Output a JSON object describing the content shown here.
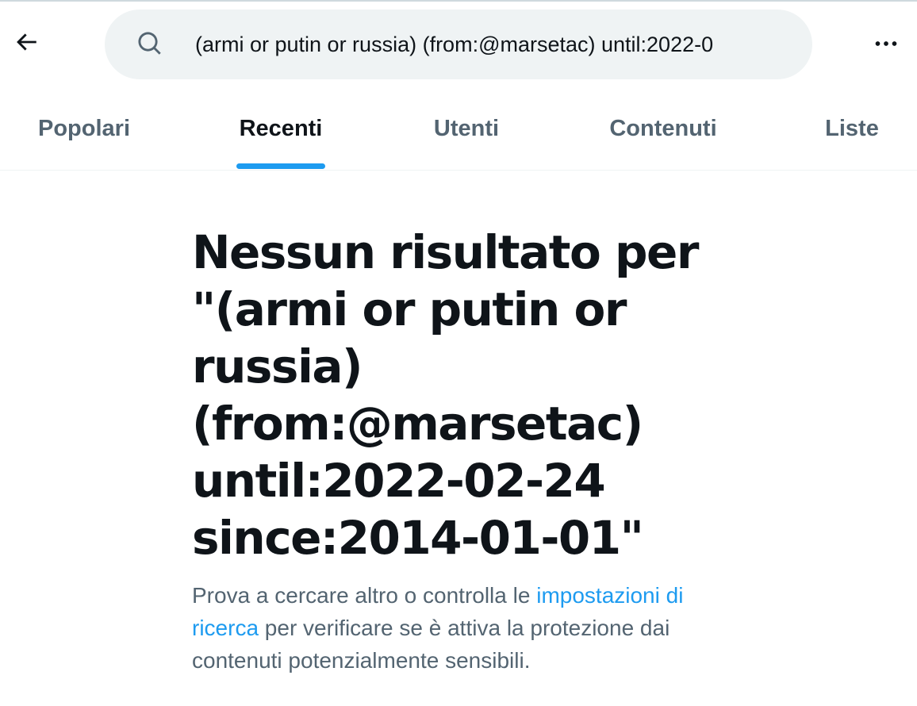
{
  "header": {
    "back_icon": "arrow-left-icon",
    "search": {
      "icon": "search-icon",
      "value": "(armi or putin or russia) (from:@marsetac) until:2022-0"
    },
    "more_icon": "more-horizontal-icon"
  },
  "tabs": [
    {
      "label": "Popolari",
      "active": false
    },
    {
      "label": "Recenti",
      "active": true
    },
    {
      "label": "Utenti",
      "active": false
    },
    {
      "label": "Contenuti",
      "active": false
    },
    {
      "label": "Liste",
      "active": false
    }
  ],
  "empty_state": {
    "title": "Nessun risultato per \"(armi or putin or russia) (from:@marsetac) until:2022-02-24 since:2014-01-01\"",
    "desc_before": "Prova a cercare altro o controlla le ",
    "desc_link": "impostazioni di ricerca",
    "desc_after": " per verificare se è attiva la protezione dai contenuti potenzialmente sensibili."
  },
  "colors": {
    "accent": "#1d9bf0",
    "text_primary": "#0f1419",
    "text_secondary": "#536471",
    "search_bg": "#eff3f4"
  }
}
